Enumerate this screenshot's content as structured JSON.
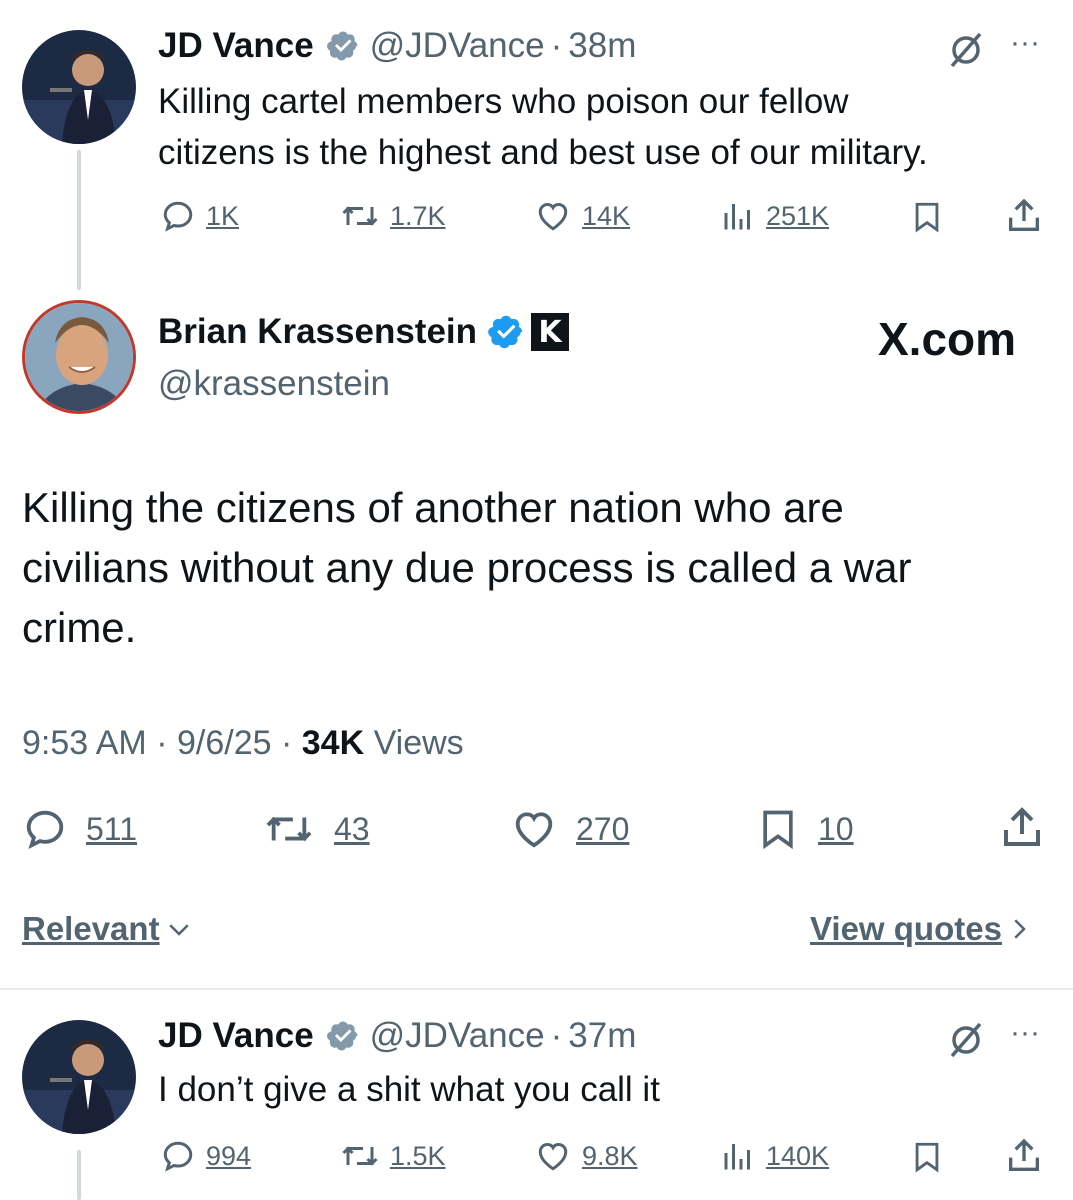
{
  "tweet1": {
    "name": "JD Vance",
    "handle": "@JDVance",
    "dot": "·",
    "time": "38m",
    "text_line1": "Killing cartel members who poison our fellow",
    "text_line2": "citizens is the highest and best use of our military.",
    "more": "···",
    "replies": "1K",
    "reposts": "1.7K",
    "likes": "14K",
    "views": "251K"
  },
  "main": {
    "name": "Brian Krassenstein",
    "handle": "@krassenstein",
    "brand": "X.com",
    "badge_letter": "K",
    "text_line1": "Killing the citizens of another nation who are",
    "text_line2": "civilians without any due process is called a war",
    "text_line3": "crime.",
    "time": "9:53 AM",
    "dot": "·",
    "date": "9/6/25",
    "views_count": "34K",
    "views_label": "Views",
    "replies": "511",
    "reposts": "43",
    "likes": "270",
    "bookmarks": "10",
    "sort_label": "Relevant",
    "quotes_label": "View quotes"
  },
  "tweet2": {
    "name": "JD Vance",
    "handle": "@JDVance",
    "dot": "·",
    "time": "37m",
    "text_line1": "I don’t give a shit what you call it",
    "more": "···",
    "replies": "994",
    "reposts": "1.5K",
    "likes": "9.8K",
    "views": "140K"
  },
  "colors": {
    "text": "#0f1419",
    "secondary": "#536471",
    "verified_blue": "#1d9bf0",
    "verified_gray": "#829aab"
  },
  "icons": [
    "reply-icon",
    "repost-icon",
    "like-icon",
    "views-icon",
    "bookmark-icon",
    "share-icon",
    "grok-icon",
    "more-icon",
    "verified-badge-icon",
    "chevron-down-icon",
    "chevron-right-icon"
  ]
}
